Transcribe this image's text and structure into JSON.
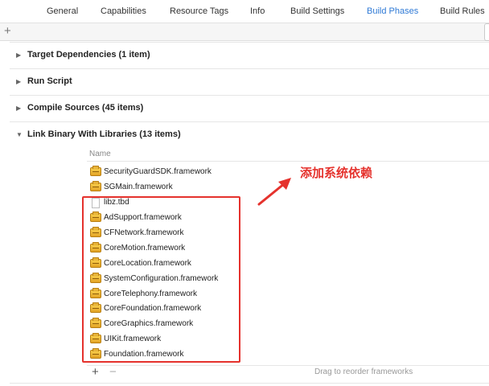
{
  "tabs": [
    {
      "label": "General"
    },
    {
      "label": "Capabilities"
    },
    {
      "label": "Resource Tags"
    },
    {
      "label": "Info"
    },
    {
      "label": "Build Settings"
    },
    {
      "label": "Build Phases",
      "active": true
    },
    {
      "label": "Build Rules"
    }
  ],
  "toolbar": {
    "add_label": "+"
  },
  "sections": [
    {
      "title": "Target Dependencies (1 item)",
      "expanded": false
    },
    {
      "title": "Run Script",
      "expanded": false
    },
    {
      "title": "Compile Sources (45 items)",
      "expanded": false
    },
    {
      "title": "Link Binary With Libraries (13 items)",
      "expanded": true
    }
  ],
  "libraries": {
    "column_header": "Name",
    "items": [
      {
        "name": "SecurityGuardSDK.framework",
        "icon": "framework-icon"
      },
      {
        "name": "SGMain.framework",
        "icon": "framework-icon"
      },
      {
        "name": "libz.tbd",
        "icon": "document-icon"
      },
      {
        "name": "AdSupport.framework",
        "icon": "framework-icon"
      },
      {
        "name": "CFNetwork.framework",
        "icon": "framework-icon"
      },
      {
        "name": "CoreMotion.framework",
        "icon": "framework-icon"
      },
      {
        "name": "CoreLocation.framework",
        "icon": "framework-icon"
      },
      {
        "name": "SystemConfiguration.framework",
        "icon": "framework-icon"
      },
      {
        "name": "CoreTelephony.framework",
        "icon": "framework-icon"
      },
      {
        "name": "CoreFoundation.framework",
        "icon": "framework-icon"
      },
      {
        "name": "CoreGraphics.framework",
        "icon": "framework-icon"
      },
      {
        "name": "UIKit.framework",
        "icon": "framework-icon"
      },
      {
        "name": "Foundation.framework",
        "icon": "framework-icon"
      }
    ],
    "add_button": "+",
    "remove_button": "−",
    "drag_hint": "Drag to reorder frameworks"
  },
  "annotation": {
    "text": "添加系统依赖",
    "color": "#e5322d"
  },
  "colors": {
    "accent": "#2f7ad6",
    "annotation": "#e5322d"
  }
}
